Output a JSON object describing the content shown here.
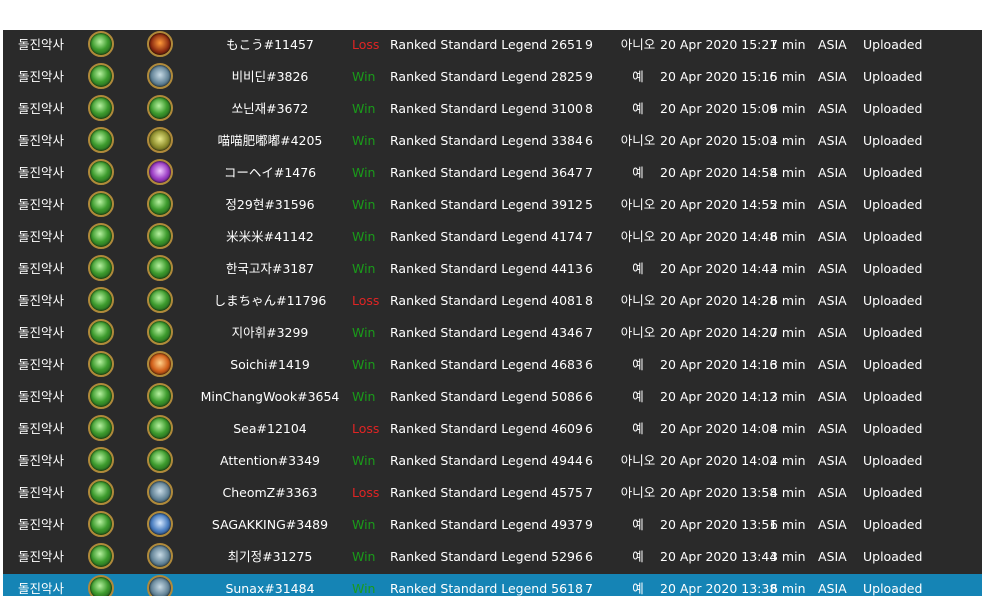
{
  "colors": {
    "table_bg": "#2a2a2a",
    "selected_row": "#1584b5",
    "win": "#1a9b1a",
    "loss": "#e02424"
  },
  "rows": [
    {
      "deck": "돌진악사",
      "hero_icon": "druid-portrait-icon",
      "opponent_icon": "rogue-portrait-icon",
      "opponent_class": "rogue",
      "name": "もこう#11457",
      "result": "Loss",
      "mode": "Ranked Standard Legend 2651",
      "turns": "9",
      "coin": "아니오",
      "date": "20 Apr 2020 15:21",
      "duration": "7 min",
      "region": "ASIA",
      "status": "Uploaded",
      "selected": false
    },
    {
      "deck": "돌진악사",
      "hero_icon": "druid-portrait-icon",
      "opponent_icon": "mage-portrait-icon",
      "opponent_class": "mage",
      "name": "비비딘#3826",
      "result": "Win",
      "mode": "Ranked Standard Legend 2825",
      "turns": "9",
      "coin": "예",
      "date": "20 Apr 2020 15:16",
      "duration": "5 min",
      "region": "ASIA",
      "status": "Uploaded",
      "selected": false
    },
    {
      "deck": "돌진악사",
      "hero_icon": "druid-portrait-icon",
      "opponent_icon": "druid-portrait-icon",
      "opponent_class": "druid",
      "name": "쏘닌재#3672",
      "result": "Win",
      "mode": "Ranked Standard Legend 3100",
      "turns": "8",
      "coin": "예",
      "date": "20 Apr 2020 15:09",
      "duration": "6 min",
      "region": "ASIA",
      "status": "Uploaded",
      "selected": false
    },
    {
      "deck": "돌진악사",
      "hero_icon": "druid-portrait-icon",
      "opponent_icon": "hunter-portrait-icon",
      "opponent_class": "hunter",
      "name": "喵喵肥嘟嘟#4205",
      "result": "Win",
      "mode": "Ranked Standard Legend 3384",
      "turns": "6",
      "coin": "아니오",
      "date": "20 Apr 2020 15:03",
      "duration": "4 min",
      "region": "ASIA",
      "status": "Uploaded",
      "selected": false
    },
    {
      "deck": "돌진악사",
      "hero_icon": "druid-portrait-icon",
      "opponent_icon": "priest-portrait-icon",
      "opponent_class": "priest",
      "name": "コーヘイ#1476",
      "result": "Win",
      "mode": "Ranked Standard Legend 3647",
      "turns": "7",
      "coin": "예",
      "date": "20 Apr 2020 14:58",
      "duration": "4 min",
      "region": "ASIA",
      "status": "Uploaded",
      "selected": false
    },
    {
      "deck": "돌진악사",
      "hero_icon": "druid-portrait-icon",
      "opponent_icon": "druid-portrait-icon",
      "opponent_class": "druid",
      "name": "정29현#31596",
      "result": "Win",
      "mode": "Ranked Standard Legend 3912",
      "turns": "5",
      "coin": "아니오",
      "date": "20 Apr 2020 14:55",
      "duration": "2 min",
      "region": "ASIA",
      "status": "Uploaded",
      "selected": false
    },
    {
      "deck": "돌진악사",
      "hero_icon": "druid-portrait-icon",
      "opponent_icon": "druid-portrait-icon",
      "opponent_class": "druid",
      "name": "米米米#41142",
      "result": "Win",
      "mode": "Ranked Standard Legend 4174",
      "turns": "7",
      "coin": "아니오",
      "date": "20 Apr 2020 14:48",
      "duration": "6 min",
      "region": "ASIA",
      "status": "Uploaded",
      "selected": false
    },
    {
      "deck": "돌진악사",
      "hero_icon": "druid-portrait-icon",
      "opponent_icon": "druid-portrait-icon",
      "opponent_class": "druid",
      "name": "한국고자#3187",
      "result": "Win",
      "mode": "Ranked Standard Legend 4413",
      "turns": "6",
      "coin": "예",
      "date": "20 Apr 2020 14:43",
      "duration": "4 min",
      "region": "ASIA",
      "status": "Uploaded",
      "selected": false
    },
    {
      "deck": "돌진악사",
      "hero_icon": "druid-portrait-icon",
      "opponent_icon": "druid-portrait-icon",
      "opponent_class": "druid",
      "name": "しまちゃん#11796",
      "result": "Loss",
      "mode": "Ranked Standard Legend 4081",
      "turns": "8",
      "coin": "아니오",
      "date": "20 Apr 2020 14:28",
      "duration": "6 min",
      "region": "ASIA",
      "status": "Uploaded",
      "selected": false
    },
    {
      "deck": "돌진악사",
      "hero_icon": "druid-portrait-icon",
      "opponent_icon": "druid-portrait-icon",
      "opponent_class": "druid",
      "name": "지아휘#3299",
      "result": "Win",
      "mode": "Ranked Standard Legend 4346",
      "turns": "7",
      "coin": "아니오",
      "date": "20 Apr 2020 14:20",
      "duration": "7 min",
      "region": "ASIA",
      "status": "Uploaded",
      "selected": false
    },
    {
      "deck": "돌진악사",
      "hero_icon": "druid-portrait-icon",
      "opponent_icon": "shaman-portrait-icon",
      "opponent_class": "shaman",
      "name": "Soichi#1419",
      "result": "Win",
      "mode": "Ranked Standard Legend 4683",
      "turns": "6",
      "coin": "예",
      "date": "20 Apr 2020 14:16",
      "duration": "3 min",
      "region": "ASIA",
      "status": "Uploaded",
      "selected": false
    },
    {
      "deck": "돌진악사",
      "hero_icon": "druid-portrait-icon",
      "opponent_icon": "druid-portrait-icon",
      "opponent_class": "druid",
      "name": "MinChangWook#3654",
      "result": "Win",
      "mode": "Ranked Standard Legend 5086",
      "turns": "6",
      "coin": "예",
      "date": "20 Apr 2020 14:12",
      "duration": "3 min",
      "region": "ASIA",
      "status": "Uploaded",
      "selected": false
    },
    {
      "deck": "돌진악사",
      "hero_icon": "druid-portrait-icon",
      "opponent_icon": "druid-portrait-icon",
      "opponent_class": "druid",
      "name": "Sea#12104",
      "result": "Loss",
      "mode": "Ranked Standard Legend 4609",
      "turns": "6",
      "coin": "예",
      "date": "20 Apr 2020 14:08",
      "duration": "4 min",
      "region": "ASIA",
      "status": "Uploaded",
      "selected": false
    },
    {
      "deck": "돌진악사",
      "hero_icon": "druid-portrait-icon",
      "opponent_icon": "druid-portrait-icon",
      "opponent_class": "druid",
      "name": "Attention#3349",
      "result": "Win",
      "mode": "Ranked Standard Legend 4944",
      "turns": "6",
      "coin": "아니오",
      "date": "20 Apr 2020 14:02",
      "duration": "4 min",
      "region": "ASIA",
      "status": "Uploaded",
      "selected": false
    },
    {
      "deck": "돌진악사",
      "hero_icon": "druid-portrait-icon",
      "opponent_icon": "mage-portrait-icon",
      "opponent_class": "mage",
      "name": "CheomZ#3363",
      "result": "Loss",
      "mode": "Ranked Standard Legend 4575",
      "turns": "7",
      "coin": "아니오",
      "date": "20 Apr 2020 13:58",
      "duration": "4 min",
      "region": "ASIA",
      "status": "Uploaded",
      "selected": false
    },
    {
      "deck": "돌진악사",
      "hero_icon": "druid-portrait-icon",
      "opponent_icon": "warrior-portrait-icon",
      "opponent_class": "warrior",
      "name": "SAGAKKING#3489",
      "result": "Win",
      "mode": "Ranked Standard Legend 4937",
      "turns": "9",
      "coin": "예",
      "date": "20 Apr 2020 13:51",
      "duration": "6 min",
      "region": "ASIA",
      "status": "Uploaded",
      "selected": false
    },
    {
      "deck": "돌진악사",
      "hero_icon": "druid-portrait-icon",
      "opponent_icon": "mage-portrait-icon",
      "opponent_class": "mage",
      "name": "최기정#31275",
      "result": "Win",
      "mode": "Ranked Standard Legend 5296",
      "turns": "6",
      "coin": "예",
      "date": "20 Apr 2020 13:44",
      "duration": "3 min",
      "region": "ASIA",
      "status": "Uploaded",
      "selected": false
    },
    {
      "deck": "돌진악사",
      "hero_icon": "druid-portrait-icon",
      "opponent_icon": "mage-portrait-icon",
      "opponent_class": "mage",
      "name": "Sunax#31484",
      "result": "Win",
      "mode": "Ranked Standard Legend 5618",
      "turns": "7",
      "coin": "예",
      "date": "20 Apr 2020 13:38",
      "duration": "6 min",
      "region": "ASIA",
      "status": "Uploaded",
      "selected": true
    }
  ]
}
